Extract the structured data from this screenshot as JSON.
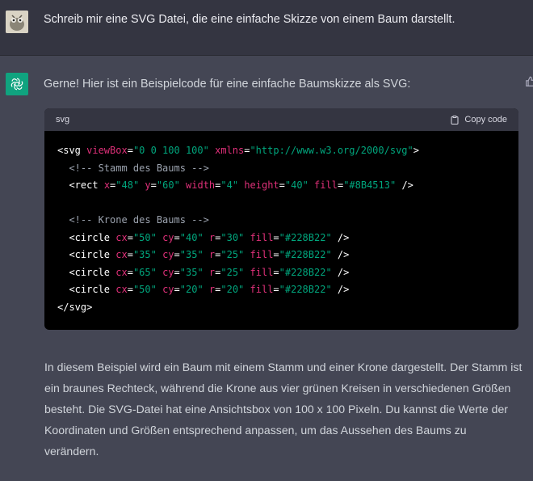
{
  "user_message": "Schreib mir eine SVG Datei, die eine einfache Skizze von einem Baum darstellt.",
  "assistant": {
    "intro": "Gerne! Hier ist ein Beispielcode für eine einfache Baumskizze als SVG:",
    "code_block": {
      "language": "svg",
      "copy_label": "Copy code",
      "lines": [
        {
          "indent": "",
          "parts": [
            {
              "t": "tag",
              "v": "<svg "
            },
            {
              "t": "attr",
              "v": "viewBox"
            },
            {
              "t": "eq",
              "v": "="
            },
            {
              "t": "str",
              "v": "\"0 0 100 100\""
            },
            {
              "t": "tag",
              "v": " "
            },
            {
              "t": "attr",
              "v": "xmlns"
            },
            {
              "t": "eq",
              "v": "="
            },
            {
              "t": "str",
              "v": "\"http://www.w3.org/2000/svg\""
            },
            {
              "t": "tag",
              "v": ">"
            }
          ]
        },
        {
          "indent": "  ",
          "parts": [
            {
              "t": "com",
              "v": "<!-- Stamm des Baums -->"
            }
          ]
        },
        {
          "indent": "  ",
          "parts": [
            {
              "t": "tag",
              "v": "<rect "
            },
            {
              "t": "attr",
              "v": "x"
            },
            {
              "t": "eq",
              "v": "="
            },
            {
              "t": "str",
              "v": "\"48\""
            },
            {
              "t": "tag",
              "v": " "
            },
            {
              "t": "attr",
              "v": "y"
            },
            {
              "t": "eq",
              "v": "="
            },
            {
              "t": "str",
              "v": "\"60\""
            },
            {
              "t": "tag",
              "v": " "
            },
            {
              "t": "attr",
              "v": "width"
            },
            {
              "t": "eq",
              "v": "="
            },
            {
              "t": "str",
              "v": "\"4\""
            },
            {
              "t": "tag",
              "v": " "
            },
            {
              "t": "attr",
              "v": "height"
            },
            {
              "t": "eq",
              "v": "="
            },
            {
              "t": "str",
              "v": "\"40\""
            },
            {
              "t": "tag",
              "v": " "
            },
            {
              "t": "attr",
              "v": "fill"
            },
            {
              "t": "eq",
              "v": "="
            },
            {
              "t": "str",
              "v": "\"#8B4513\""
            },
            {
              "t": "tag",
              "v": " />"
            }
          ]
        },
        {
          "indent": "",
          "parts": []
        },
        {
          "indent": "  ",
          "parts": [
            {
              "t": "com",
              "v": "<!-- Krone des Baums -->"
            }
          ]
        },
        {
          "indent": "  ",
          "parts": [
            {
              "t": "tag",
              "v": "<circle "
            },
            {
              "t": "attr",
              "v": "cx"
            },
            {
              "t": "eq",
              "v": "="
            },
            {
              "t": "str",
              "v": "\"50\""
            },
            {
              "t": "tag",
              "v": " "
            },
            {
              "t": "attr",
              "v": "cy"
            },
            {
              "t": "eq",
              "v": "="
            },
            {
              "t": "str",
              "v": "\"40\""
            },
            {
              "t": "tag",
              "v": " "
            },
            {
              "t": "attr",
              "v": "r"
            },
            {
              "t": "eq",
              "v": "="
            },
            {
              "t": "str",
              "v": "\"30\""
            },
            {
              "t": "tag",
              "v": " "
            },
            {
              "t": "attr",
              "v": "fill"
            },
            {
              "t": "eq",
              "v": "="
            },
            {
              "t": "str",
              "v": "\"#228B22\""
            },
            {
              "t": "tag",
              "v": " />"
            }
          ]
        },
        {
          "indent": "  ",
          "parts": [
            {
              "t": "tag",
              "v": "<circle "
            },
            {
              "t": "attr",
              "v": "cx"
            },
            {
              "t": "eq",
              "v": "="
            },
            {
              "t": "str",
              "v": "\"35\""
            },
            {
              "t": "tag",
              "v": " "
            },
            {
              "t": "attr",
              "v": "cy"
            },
            {
              "t": "eq",
              "v": "="
            },
            {
              "t": "str",
              "v": "\"35\""
            },
            {
              "t": "tag",
              "v": " "
            },
            {
              "t": "attr",
              "v": "r"
            },
            {
              "t": "eq",
              "v": "="
            },
            {
              "t": "str",
              "v": "\"25\""
            },
            {
              "t": "tag",
              "v": " "
            },
            {
              "t": "attr",
              "v": "fill"
            },
            {
              "t": "eq",
              "v": "="
            },
            {
              "t": "str",
              "v": "\"#228B22\""
            },
            {
              "t": "tag",
              "v": " />"
            }
          ]
        },
        {
          "indent": "  ",
          "parts": [
            {
              "t": "tag",
              "v": "<circle "
            },
            {
              "t": "attr",
              "v": "cx"
            },
            {
              "t": "eq",
              "v": "="
            },
            {
              "t": "str",
              "v": "\"65\""
            },
            {
              "t": "tag",
              "v": " "
            },
            {
              "t": "attr",
              "v": "cy"
            },
            {
              "t": "eq",
              "v": "="
            },
            {
              "t": "str",
              "v": "\"35\""
            },
            {
              "t": "tag",
              "v": " "
            },
            {
              "t": "attr",
              "v": "r"
            },
            {
              "t": "eq",
              "v": "="
            },
            {
              "t": "str",
              "v": "\"25\""
            },
            {
              "t": "tag",
              "v": " "
            },
            {
              "t": "attr",
              "v": "fill"
            },
            {
              "t": "eq",
              "v": "="
            },
            {
              "t": "str",
              "v": "\"#228B22\""
            },
            {
              "t": "tag",
              "v": " />"
            }
          ]
        },
        {
          "indent": "  ",
          "parts": [
            {
              "t": "tag",
              "v": "<circle "
            },
            {
              "t": "attr",
              "v": "cx"
            },
            {
              "t": "eq",
              "v": "="
            },
            {
              "t": "str",
              "v": "\"50\""
            },
            {
              "t": "tag",
              "v": " "
            },
            {
              "t": "attr",
              "v": "cy"
            },
            {
              "t": "eq",
              "v": "="
            },
            {
              "t": "str",
              "v": "\"20\""
            },
            {
              "t": "tag",
              "v": " "
            },
            {
              "t": "attr",
              "v": "r"
            },
            {
              "t": "eq",
              "v": "="
            },
            {
              "t": "str",
              "v": "\"20\""
            },
            {
              "t": "tag",
              "v": " "
            },
            {
              "t": "attr",
              "v": "fill"
            },
            {
              "t": "eq",
              "v": "="
            },
            {
              "t": "str",
              "v": "\"#228B22\""
            },
            {
              "t": "tag",
              "v": " />"
            }
          ]
        },
        {
          "indent": "",
          "parts": [
            {
              "t": "tag",
              "v": "</svg>"
            }
          ]
        }
      ]
    },
    "explanation": "In diesem Beispiel wird ein Baum mit einem Stamm und einer Krone dargestellt. Der Stamm ist ein braunes Rechteck, während die Krone aus vier grünen Kreisen in verschiedenen Größen besteht. Die SVG-Datei hat eine Ansichtsbox von 100 x 100 Pixeln. Du kannst die Werte der Koordinaten und Größen entsprechend anpassen, um das Aussehen des Baums zu verändern."
  },
  "icons": {
    "user_avatar": "user-avatar-icon",
    "assistant_avatar": "openai-logo-icon",
    "copy": "clipboard-icon",
    "feedback": "thumbs-up-icon"
  },
  "colors": {
    "user_bg": "#343541",
    "assistant_bg": "#444654",
    "brand_green": "#10a37f",
    "code_attr": "#df3079",
    "code_string": "#00a67d"
  }
}
